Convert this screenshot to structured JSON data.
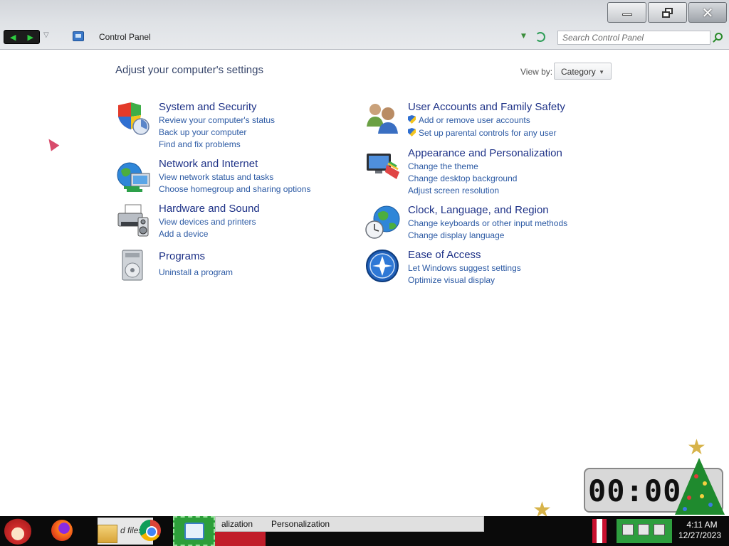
{
  "window": {
    "address": "Control Panel",
    "search_placeholder": "Search Control Panel"
  },
  "main": {
    "heading": "Adjust your computer's settings",
    "view_by_label": "View by:",
    "view_by_value": "Category"
  },
  "categories": {
    "system": {
      "title": "System and Security",
      "links": [
        "Review your computer's status",
        "Back up your computer",
        "Find and fix problems"
      ],
      "icon": "shield-icon"
    },
    "network": {
      "title": "Network and Internet",
      "links": [
        "View network status and tasks",
        "Choose homegroup and sharing options"
      ],
      "icon": "globe-network-icon"
    },
    "hardware": {
      "title": "Hardware and Sound",
      "links": [
        "View devices and printers",
        "Add a device"
      ],
      "icon": "printer-icon"
    },
    "programs": {
      "title": "Programs",
      "links": [
        "Uninstall a program"
      ],
      "icon": "programs-icon"
    },
    "users": {
      "title": "User Accounts and Family Safety",
      "links": [
        "Add or remove user accounts",
        "Set up parental controls for any user"
      ],
      "icon": "users-icon"
    },
    "appearance": {
      "title": "Appearance and Personalization",
      "links": [
        "Change the theme",
        "Change desktop background",
        "Adjust screen resolution"
      ],
      "icon": "monitor-paint-icon"
    },
    "clock": {
      "title": "Clock, Language, and Region",
      "links": [
        "Change keyboards or other input methods",
        "Change display language"
      ],
      "icon": "clock-globe-icon"
    },
    "ease": {
      "title": "Ease of Access",
      "links": [
        "Let Windows suggest settings",
        "Optimize visual display"
      ],
      "icon": "ease-of-access-icon"
    }
  },
  "gadget": {
    "clock_display": "00:00:"
  },
  "taskbar": {
    "files_label": "d files",
    "window1": "alization",
    "window2": "Personalization",
    "time": "4:11 AM",
    "date": "12/27/2023"
  }
}
